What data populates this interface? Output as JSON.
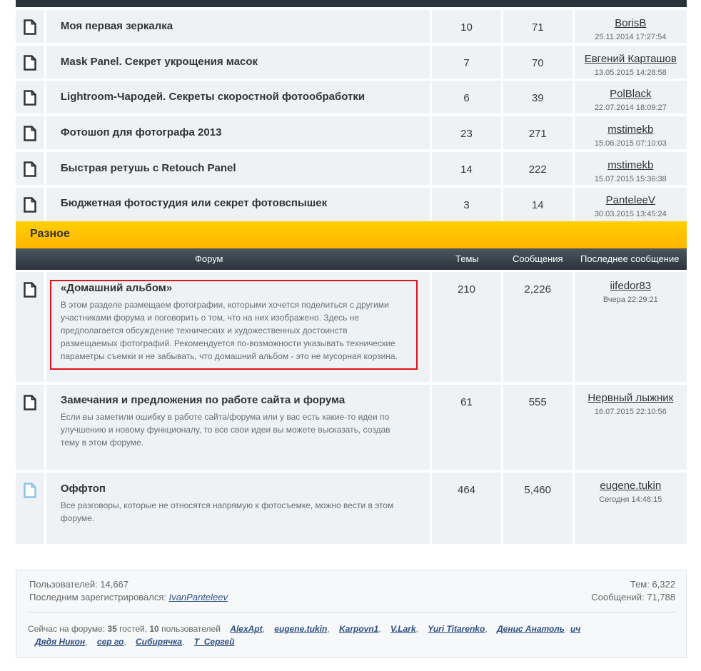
{
  "top_forums": [
    {
      "name": "Моя первая зеркалка",
      "topics": "10",
      "posts": "71",
      "last_user": "BorisB",
      "last_date": "25.11.2014 17:27:54"
    },
    {
      "name": "Mask Panel. Секрет укрощения масок",
      "topics": "7",
      "posts": "70",
      "last_user": "Евгений Карташов",
      "last_date": "13.05.2015 14:28:58"
    },
    {
      "name": "Lightroom-Чародей. Секреты скоростной фотообработки",
      "topics": "6",
      "posts": "39",
      "last_user": "PolBlack",
      "last_date": "22.07.2014 18:09:27"
    },
    {
      "name": "Фотошоп для фотографа 2013",
      "topics": "23",
      "posts": "271",
      "last_user": "mstimekb",
      "last_date": "15.06.2015 07:10:03"
    },
    {
      "name": "Быстрая ретушь с Retouch Panel",
      "topics": "14",
      "posts": "222",
      "last_user": "mstimekb",
      "last_date": "15.07.2015 15:36:38"
    },
    {
      "name": "Бюджетная фотостудия или секрет фотовспышек",
      "topics": "3",
      "posts": "14",
      "last_user": "PanteleeV",
      "last_date": "30.03.2015 13:45:24"
    }
  ],
  "category": {
    "title": "Разное"
  },
  "header": {
    "forum": "Форум",
    "topics": "Темы",
    "posts": "Сообщения",
    "last": "Последнее сообщение"
  },
  "misc_forums": [
    {
      "name": "«Домашний альбом»",
      "desc": "В этом разделе размещаем фотографии, которыми хочется поделиться с другими участниками форума и поговорить о том, что на них изображено. Здесь не предполагается обсуждение технических и художественных достоинств размещаемых фотографий. Рекомендуется по-возможности указывать технические параметры съемки и не забывать, что домашний альбом - это не мусорная корзина.",
      "topics": "210",
      "posts": "2,226",
      "last_user": "iifedor83",
      "last_date": "Вчера 22:29:21"
    },
    {
      "name": "Замечания и предложения по работе сайта и форума",
      "desc": "Если вы заметили ошибку в работе сайта/форума или у вас есть какие-то идеи по улучшению и новому функционалу, то все свои идеи вы можете высказать, создав тему в этом форуме.",
      "topics": "61",
      "posts": "555",
      "last_user": "Нервный лыжник",
      "last_date": "16.07.2015 22:10:56"
    },
    {
      "name": "Оффтоп",
      "desc": "Все разговоры, которые не относятся напрямую к фотосъемке, можно вести в этом форуме.",
      "topics": "464",
      "posts": "5,460",
      "last_user": "eugene.tukin",
      "last_date": "Сегодня 14:48:15"
    }
  ],
  "stats": {
    "users": "Пользователей: 14,667",
    "last_reg_label": "Последним зарегистрировался:",
    "last_reg_user": "IvanPanteleev",
    "topics": "Тем: 6,322",
    "posts": "Сообщений: 71,788",
    "online_prefix": "Сейчас на форуме: ",
    "guests_count": "35",
    "guests_word": " гостей, ",
    "users_count": "10",
    "users_word": " пользователей",
    "online_users": [
      "AlexApt",
      "eugene.tukin",
      "Karpovn1",
      "V.Lark",
      "Yuri Titarenko",
      "Денис Анатоль",
      "ич",
      "Дядя Никон",
      "сер го",
      "Сибирячка",
      "Т_Сергей"
    ]
  }
}
